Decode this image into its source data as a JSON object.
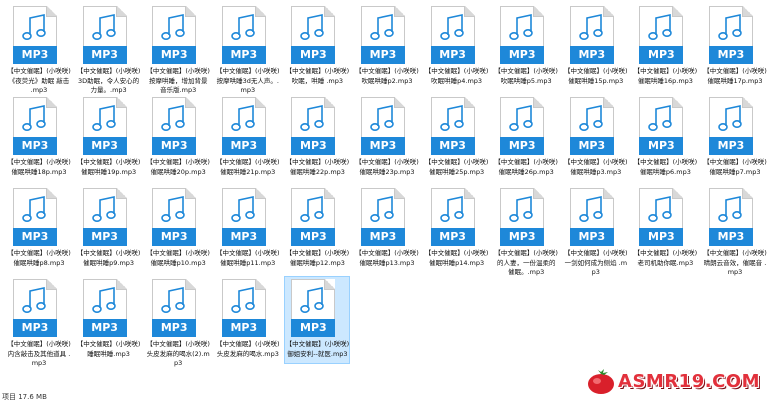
{
  "files": [
    {
      "badge": "MP3",
      "name": "【中文催眠】(小咲咲)《夜荧光》助眠 敲击 .mp3"
    },
    {
      "badge": "MP3",
      "name": "【中文催眠】(小咲咲)3D助眠，令人安心的力量。.mp3"
    },
    {
      "badge": "MP3",
      "name": "【中文催眠】(小咲咲)按摩哄睡，增加背景音乐版.mp3"
    },
    {
      "badge": "MP3",
      "name": "【中文催眠】(小咲咲)按摩哄睡3d无人声。.mp3"
    },
    {
      "badge": "MP3",
      "name": "【中文催眠】(小咲咲)吹眠，哄睡 .mp3"
    },
    {
      "badge": "MP3",
      "name": "【中文催眠】(小咲咲)吹眠哄睡p2.mp3"
    },
    {
      "badge": "MP3",
      "name": "【中文催眠】(小咲咲)吹眠哄睡p4.mp3"
    },
    {
      "badge": "MP3",
      "name": "【中文催眠】(小咲咲)吹眠哄睡p5.mp3"
    },
    {
      "badge": "MP3",
      "name": "【中文催眠】(小咲咲)催眠哄睡15p.mp3"
    },
    {
      "badge": "MP3",
      "name": "【中文催眠】(小咲咲)催眠哄睡16p.mp3"
    },
    {
      "badge": "MP3",
      "name": "【中文催眠】(小咲咲)催眠哄睡17p.mp3"
    },
    {
      "badge": "MP3",
      "name": "【中文催眠】(小咲咲)催眠哄睡18p.mp3"
    },
    {
      "badge": "MP3",
      "name": "【中文催眠】(小咲咲)催眠哄睡19p.mp3"
    },
    {
      "badge": "MP3",
      "name": "【中文催眠】(小咲咲)催眠哄睡20p.mp3"
    },
    {
      "badge": "MP3",
      "name": "【中文催眠】(小咲咲)催眠哄睡21p.mp3"
    },
    {
      "badge": "MP3",
      "name": "【中文催眠】(小咲咲)催眠哄睡22p.mp3"
    },
    {
      "badge": "MP3",
      "name": "【中文催眠】(小咲咲)催眠哄睡23p.mp3"
    },
    {
      "badge": "MP3",
      "name": "【中文催眠】(小咲咲)催眠哄睡25p.mp3"
    },
    {
      "badge": "MP3",
      "name": "【中文催眠】(小咲咲)催眠哄睡26p.mp3"
    },
    {
      "badge": "MP3",
      "name": "【中文催眠】(小咲咲)催眠哄睡p3.mp3"
    },
    {
      "badge": "MP3",
      "name": "【中文催眠】(小咲咲)催眠哄睡p6.mp3"
    },
    {
      "badge": "MP3",
      "name": "【中文催眠】(小咲咲)催眠哄睡p7.mp3"
    },
    {
      "badge": "MP3",
      "name": "【中文催眠】(小咲咲)催眠哄睡p8.mp3"
    },
    {
      "badge": "MP3",
      "name": "【中文催眠】(小咲咲)催眠哄睡p9.mp3"
    },
    {
      "badge": "MP3",
      "name": "【中文催眠】(小咲咲)催眠哄睡p10.mp3"
    },
    {
      "badge": "MP3",
      "name": "【中文催眠】(小咲咲)催眠哄睡p11.mp3"
    },
    {
      "badge": "MP3",
      "name": "【中文催眠】(小咲咲)催眠哄睡p12.mp3"
    },
    {
      "badge": "MP3",
      "name": "【中文催眠】(小咲咲)催眠哄睡p13.mp3"
    },
    {
      "badge": "MP3",
      "name": "【中文催眠】(小咲咲)催眠哄睡p14.mp3"
    },
    {
      "badge": "MP3",
      "name": "【中文催眠】(小咲咲)的人妻，一份温柔的催眠。.mp3"
    },
    {
      "badge": "MP3",
      "name": "【中文催眠】(小咲咲)一剑如何成为侧焰 .mp3"
    },
    {
      "badge": "MP3",
      "name": "【中文催眠】(小咲咲)老司机助你眠.mp3"
    },
    {
      "badge": "MP3",
      "name": "【中文催眠】(小咲咲)晴朗云音效，催眠音 .mp3"
    },
    {
      "badge": "MP3",
      "name": "【中文催眠】(小咲咲)内含敲击及其他道具 .mp3"
    },
    {
      "badge": "MP3",
      "name": "【中文催眠】(小咲咲)睡眠哄睡.mp3"
    },
    {
      "badge": "MP3",
      "name": "【中文催眠】(小咲咲)头皮发麻的喝水(2).mp3"
    },
    {
      "badge": "MP3",
      "name": "【中文催眠】(小咲咲)头皮发麻的喝水.mp3"
    },
    {
      "badge": "MP3",
      "name": "【中文催眠】(小咲咲)御姐安利--就医.mp3"
    }
  ],
  "selected_index": 37,
  "status_text": "项目 17.6 MB",
  "watermark": "ASMR19.COM",
  "colors": {
    "badge": "#1e88d9",
    "selection": "#cce8ff",
    "watermark": "#e2313c"
  }
}
